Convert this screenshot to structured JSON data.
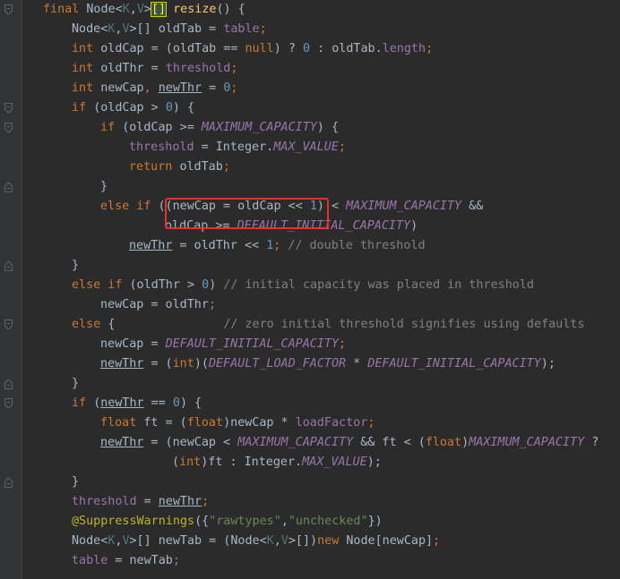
{
  "code": {
    "lines": [
      [
        {
          "t": "final ",
          "c": "kw"
        },
        {
          "t": "Node<",
          "c": ""
        },
        {
          "t": "K",
          "c": "tp"
        },
        {
          "t": ",",
          "c": ""
        },
        {
          "t": "V",
          "c": "tp"
        },
        {
          "t": ">",
          "c": ""
        },
        {
          "t": "[]",
          "c": "brk"
        },
        {
          "t": " ",
          "c": ""
        },
        {
          "t": "resize",
          "c": "fn"
        },
        {
          "t": "() {",
          "c": ""
        }
      ],
      [
        {
          "t": "Node<",
          "c": ""
        },
        {
          "t": "K",
          "c": "tp"
        },
        {
          "t": ",",
          "c": ""
        },
        {
          "t": "V",
          "c": "tp"
        },
        {
          "t": ">[] oldTab = ",
          "c": ""
        },
        {
          "t": "table",
          "c": "fld"
        },
        {
          "t": ";",
          "c": "kw"
        }
      ],
      [
        {
          "t": "int ",
          "c": "kw"
        },
        {
          "t": "oldCap = (oldTab == ",
          "c": ""
        },
        {
          "t": "null",
          "c": "kw"
        },
        {
          "t": ") ? ",
          "c": ""
        },
        {
          "t": "0",
          "c": "num"
        },
        {
          "t": " : oldTab.",
          "c": ""
        },
        {
          "t": "length",
          "c": "fld"
        },
        {
          "t": ";",
          "c": "kw"
        }
      ],
      [
        {
          "t": "int ",
          "c": "kw"
        },
        {
          "t": "oldThr = ",
          "c": ""
        },
        {
          "t": "threshold",
          "c": "fld"
        },
        {
          "t": ";",
          "c": "kw"
        }
      ],
      [
        {
          "t": "int ",
          "c": "kw"
        },
        {
          "t": "newCap",
          "c": ""
        },
        {
          "t": ", ",
          "c": "kw"
        },
        {
          "t": "newThr",
          "c": "ul"
        },
        {
          "t": " = ",
          "c": ""
        },
        {
          "t": "0",
          "c": "num"
        },
        {
          "t": ";",
          "c": "kw"
        }
      ],
      [
        {
          "t": "if ",
          "c": "kw"
        },
        {
          "t": "(oldCap > ",
          "c": ""
        },
        {
          "t": "0",
          "c": "num"
        },
        {
          "t": ") {",
          "c": ""
        }
      ],
      [
        {
          "t": "if ",
          "c": "kw"
        },
        {
          "t": "(oldCap >= ",
          "c": ""
        },
        {
          "t": "MAXIMUM_CAPACITY",
          "c": "cst"
        },
        {
          "t": ") {",
          "c": ""
        }
      ],
      [
        {
          "t": "threshold",
          "c": "fld"
        },
        {
          "t": " = Integer.",
          "c": ""
        },
        {
          "t": "MAX_VALUE",
          "c": "cst"
        },
        {
          "t": ";",
          "c": "kw"
        }
      ],
      [
        {
          "t": "return ",
          "c": "kw"
        },
        {
          "t": "oldTab",
          "c": ""
        },
        {
          "t": ";",
          "c": "kw"
        }
      ],
      [
        {
          "t": "}",
          "c": ""
        }
      ],
      [
        {
          "t": "else if ",
          "c": "kw"
        },
        {
          "t": "((newCap = oldCap << ",
          "c": ""
        },
        {
          "t": "1",
          "c": "num"
        },
        {
          "t": ") < ",
          "c": ""
        },
        {
          "t": "MAXIMUM_CAPACITY",
          "c": "cst"
        },
        {
          "t": " &&",
          "c": ""
        }
      ],
      [
        {
          "t": "oldCap >= ",
          "c": ""
        },
        {
          "t": "DEFAULT_INITIAL_CAPACITY",
          "c": "cst"
        },
        {
          "t": ")",
          "c": ""
        }
      ],
      [
        {
          "t": "newThr",
          "c": "ul"
        },
        {
          "t": " = oldThr << ",
          "c": ""
        },
        {
          "t": "1",
          "c": "num"
        },
        {
          "t": "; ",
          "c": "kw"
        },
        {
          "t": "// double threshold",
          "c": "cmt"
        }
      ],
      [
        {
          "t": "}",
          "c": ""
        }
      ],
      [
        {
          "t": "else if ",
          "c": "kw"
        },
        {
          "t": "(oldThr > ",
          "c": ""
        },
        {
          "t": "0",
          "c": "num"
        },
        {
          "t": ") ",
          "c": ""
        },
        {
          "t": "// initial capacity was placed in threshold",
          "c": "cmt"
        }
      ],
      [
        {
          "t": "newCap = oldThr",
          "c": ""
        },
        {
          "t": ";",
          "c": "kw"
        }
      ],
      [
        {
          "t": "else ",
          "c": "kw"
        },
        {
          "t": "{               ",
          "c": ""
        },
        {
          "t": "// zero initial threshold signifies using defaults",
          "c": "cmt"
        }
      ],
      [
        {
          "t": "newCap = ",
          "c": ""
        },
        {
          "t": "DEFAULT_INITIAL_CAPACITY",
          "c": "cst"
        },
        {
          "t": ";",
          "c": "kw"
        }
      ],
      [
        {
          "t": "newThr",
          "c": "ul"
        },
        {
          "t": " = (",
          "c": ""
        },
        {
          "t": "int",
          "c": "kw"
        },
        {
          "t": ")(",
          "c": ""
        },
        {
          "t": "DEFAULT_LOAD_FACTOR",
          "c": "cst"
        },
        {
          "t": " * ",
          "c": ""
        },
        {
          "t": "DEFAULT_INITIAL_CAPACITY",
          "c": "cst"
        },
        {
          "t": ");",
          "c": ""
        }
      ],
      [
        {
          "t": "}",
          "c": ""
        }
      ],
      [
        {
          "t": "if ",
          "c": "kw"
        },
        {
          "t": "(",
          "c": ""
        },
        {
          "t": "newThr",
          "c": "ul"
        },
        {
          "t": " == ",
          "c": ""
        },
        {
          "t": "0",
          "c": "num"
        },
        {
          "t": ") {",
          "c": ""
        }
      ],
      [
        {
          "t": "float ",
          "c": "kw"
        },
        {
          "t": "ft = (",
          "c": ""
        },
        {
          "t": "float",
          "c": "kw"
        },
        {
          "t": ")newCap * ",
          "c": ""
        },
        {
          "t": "loadFactor",
          "c": "fld"
        },
        {
          "t": ";",
          "c": "kw"
        }
      ],
      [
        {
          "t": "newThr",
          "c": "ul"
        },
        {
          "t": " = (newCap < ",
          "c": ""
        },
        {
          "t": "MAXIMUM_CAPACITY",
          "c": "cst"
        },
        {
          "t": " && ft < (",
          "c": ""
        },
        {
          "t": "float",
          "c": "kw"
        },
        {
          "t": ")",
          "c": ""
        },
        {
          "t": "MAXIMUM_CAPACITY",
          "c": "cst"
        },
        {
          "t": " ?",
          "c": ""
        }
      ],
      [
        {
          "t": "(",
          "c": ""
        },
        {
          "t": "int",
          "c": "kw"
        },
        {
          "t": ")ft : Integer.",
          "c": ""
        },
        {
          "t": "MAX_VALUE",
          "c": "cst"
        },
        {
          "t": ");",
          "c": ""
        }
      ],
      [
        {
          "t": "}",
          "c": ""
        }
      ],
      [
        {
          "t": "threshold",
          "c": "fld"
        },
        {
          "t": " = ",
          "c": ""
        },
        {
          "t": "newThr",
          "c": "ul"
        },
        {
          "t": ";",
          "c": "kw"
        }
      ],
      [
        {
          "t": "@SuppressWarnings",
          "c": "ann"
        },
        {
          "t": "({",
          "c": ""
        },
        {
          "t": "\"rawtypes\"",
          "c": "str"
        },
        {
          "t": ",",
          "c": ""
        },
        {
          "t": "\"unchecked\"",
          "c": "str"
        },
        {
          "t": "})",
          "c": ""
        }
      ],
      [
        {
          "t": "Node<",
          "c": ""
        },
        {
          "t": "K",
          "c": "tp"
        },
        {
          "t": ",",
          "c": ""
        },
        {
          "t": "V",
          "c": "tp"
        },
        {
          "t": ">[] newTab = (Node<",
          "c": ""
        },
        {
          "t": "K",
          "c": "tp"
        },
        {
          "t": ",",
          "c": ""
        },
        {
          "t": "V",
          "c": "tp"
        },
        {
          "t": ">[])",
          "c": ""
        },
        {
          "t": "new ",
          "c": "kw"
        },
        {
          "t": "Node[newCap]",
          "c": ""
        },
        {
          "t": ";",
          "c": "kw"
        }
      ],
      [
        {
          "t": "table",
          "c": "fld"
        },
        {
          "t": " = newTab",
          "c": ""
        },
        {
          "t": ";",
          "c": "kw"
        }
      ]
    ]
  },
  "colors": {
    "background": "#2b2b2b",
    "keyword": "#cc7832",
    "number": "#6897bb",
    "constant": "#9876aa",
    "comment": "#808080",
    "string": "#6a8759",
    "annotation": "#bbb529",
    "highlight_box": "#e8312e"
  }
}
